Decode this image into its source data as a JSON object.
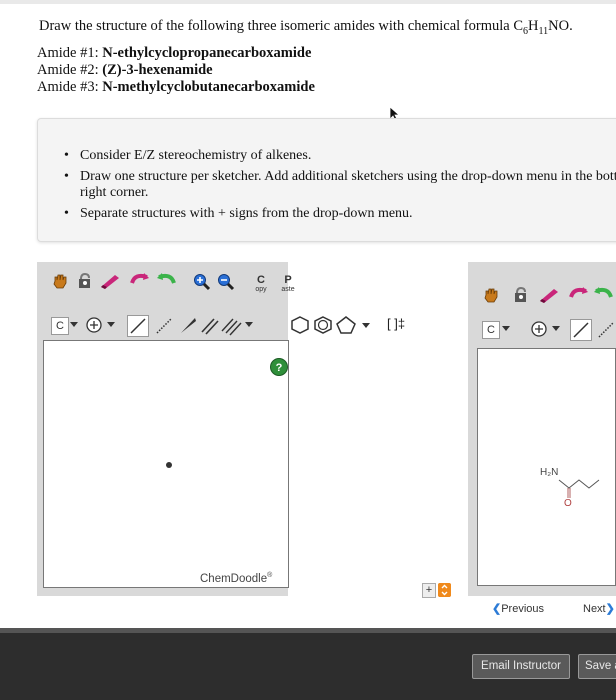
{
  "question": {
    "prefix": "Draw the structure of the following three isomeric amides with chemical formula C",
    "sub6": "6",
    "h": "H",
    "sub11": "11",
    "suffix": "NO."
  },
  "amides": [
    {
      "label": "Amide #1:",
      "name": "N-ethylcyclopropanecarboxamide"
    },
    {
      "label": "Amide #2:",
      "name": "(Z)-3-hexenamide"
    },
    {
      "label": "Amide #3:",
      "name": "N-methylcyclobutanecarboxamide"
    }
  ],
  "instructions": [
    "Consider E/Z stereochemistry of alkenes.",
    "Draw one structure per sketcher. Add additional sketchers using the drop-down menu in the bottom right corner.",
    "Separate structures with + signs from the drop-down menu."
  ],
  "toolbar": {
    "copy_top": "C",
    "copy_bottom": "opy",
    "paste_top": "P",
    "paste_bottom": "aste",
    "element": "C",
    "bracket": "[ ]‡"
  },
  "sketcher": {
    "watermark": "ChemDoodle",
    "watermark_mark": "®",
    "help": "?",
    "right_atom_label": "H₂N",
    "right_o_label": "O"
  },
  "controls": {
    "plus": "+",
    "previous": "Previous",
    "next": "Next"
  },
  "footer": {
    "email": "Email Instructor",
    "save": "Save a"
  },
  "colors": {
    "toolbar_bg": "#d9d9d9",
    "dropdown_orange": "#f08a1c",
    "footer_bg": "#2d2d2d"
  }
}
